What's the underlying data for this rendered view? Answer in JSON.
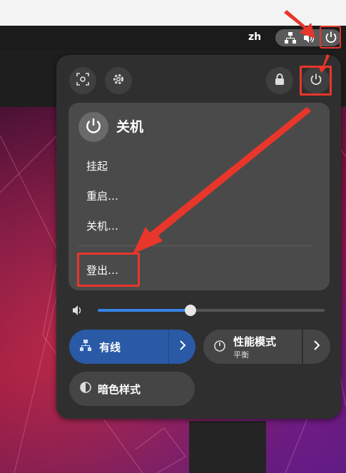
{
  "topbar": {
    "language": "zh"
  },
  "power_menu": {
    "title": "关机",
    "items": [
      {
        "label": "挂起"
      },
      {
        "label": "重启…"
      },
      {
        "label": "关机…"
      },
      {
        "label": "登出…"
      }
    ]
  },
  "volume": {
    "level_fraction": 0.41
  },
  "quick_settings": {
    "wired_label": "有线",
    "performance_label": "性能模式",
    "performance_value": "平衡",
    "dark_style_label": "暗色样式"
  },
  "colors": {
    "accent": "#3584e4",
    "annotation_red": "#e8362b",
    "menu_bg": "#2f2f2f",
    "card_bg": "#4a4a4a"
  },
  "icons": {
    "screenshot": "screenshot-icon",
    "settings": "gear-icon",
    "lock": "lock-icon",
    "power": "power-icon",
    "network": "network-wired-icon",
    "volume": "speaker-icon",
    "performance": "speedometer-icon",
    "dark_style": "half-circle-icon",
    "chevron": "chevron-right-icon"
  }
}
